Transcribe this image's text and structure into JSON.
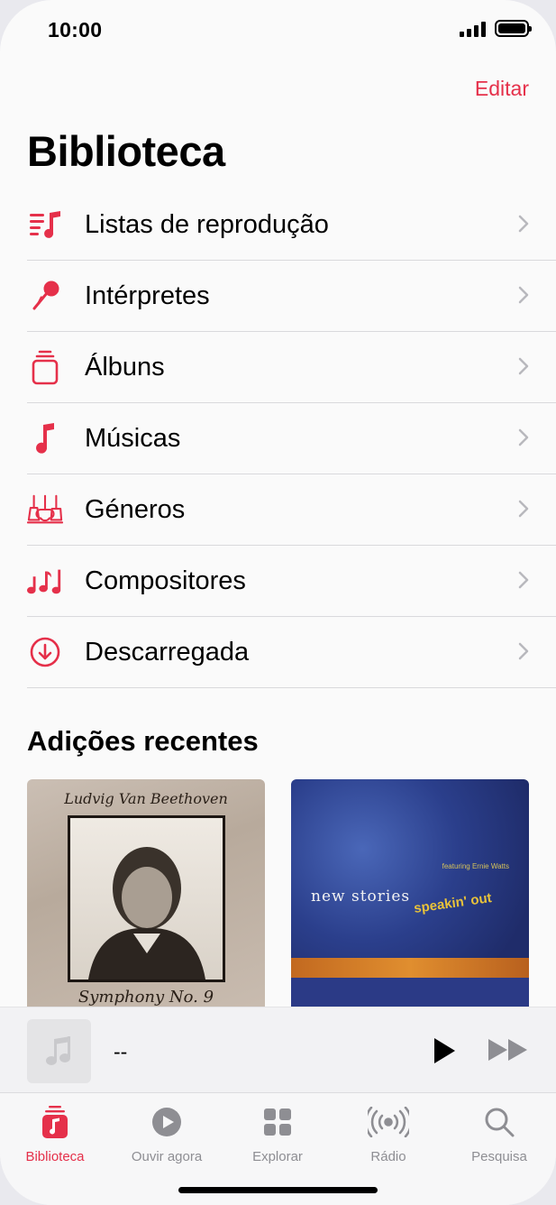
{
  "status_bar": {
    "time": "10:00"
  },
  "header": {
    "edit_label": "Editar",
    "title": "Biblioteca"
  },
  "menu": [
    {
      "label": "Listas de reprodução",
      "icon": "playlist-icon"
    },
    {
      "label": "Intérpretes",
      "icon": "microphone-icon"
    },
    {
      "label": "Álbuns",
      "icon": "album-stack-icon"
    },
    {
      "label": "Músicas",
      "icon": "music-note-icon"
    },
    {
      "label": "Géneros",
      "icon": "guitars-icon"
    },
    {
      "label": "Compositores",
      "icon": "music-notes-icon"
    },
    {
      "label": "Descarregada",
      "icon": "download-circle-icon"
    }
  ],
  "recent": {
    "title": "Adições recentes",
    "albums": [
      {
        "cover_top": "Ludvig Van Beethoven",
        "cover_bottom": "Symphony No. 9"
      },
      {
        "cover_title": "new stories",
        "cover_sub": "speakin' out",
        "cover_small": "featuring Ernie Watts"
      }
    ]
  },
  "player": {
    "title": "--"
  },
  "tabs": [
    {
      "label": "Biblioteca",
      "icon": "library-icon",
      "active": true
    },
    {
      "label": "Ouvir agora",
      "icon": "play-circle-icon",
      "active": false
    },
    {
      "label": "Explorar",
      "icon": "grid-icon",
      "active": false
    },
    {
      "label": "Rádio",
      "icon": "radio-waves-icon",
      "active": false
    },
    {
      "label": "Pesquisa",
      "icon": "search-icon",
      "active": false
    }
  ],
  "colors": {
    "accent": "#e5304a",
    "inactive": "#8e8e93",
    "background": "#fafafa"
  }
}
